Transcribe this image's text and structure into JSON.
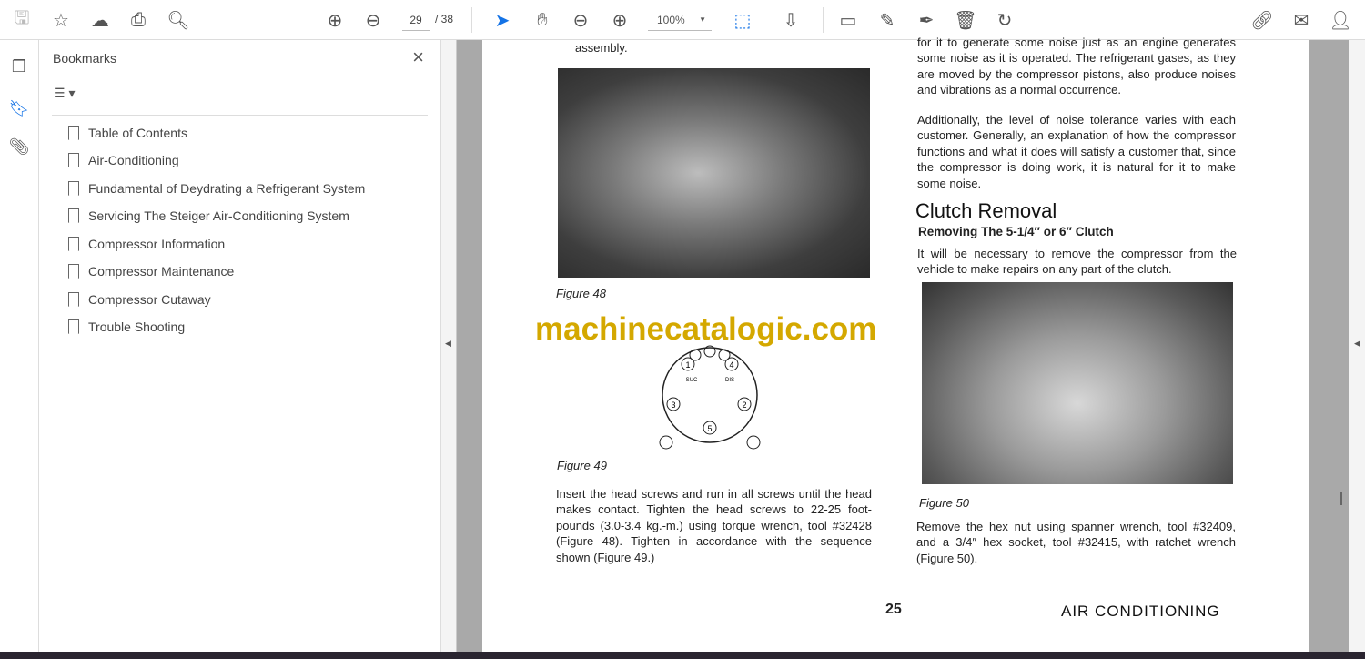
{
  "toolbar": {
    "page_current": "29",
    "page_total": "/ 38",
    "zoom": "100%",
    "icons": [
      "save-icon",
      "bookmark-star-icon",
      "upload-cloud-icon",
      "print-icon",
      "search-zoom-icon",
      "prev-page-icon",
      "next-page-icon",
      "select-cursor-icon",
      "hand-icon",
      "zoom-out-icon",
      "zoom-in-icon",
      "page-fit-icon",
      "scroll-mode-icon",
      "comment-icon",
      "highlight-icon",
      "sign-icon",
      "delete-icon",
      "rotate-icon",
      "link-icon",
      "email-icon",
      "account-icon"
    ]
  },
  "bookmarks": {
    "title": "Bookmarks",
    "items": [
      "Table of Contents",
      "Air-Conditioning",
      "Fundamental of Deydrating a Refrigerant System",
      "Servicing The Steiger Air-Conditioning System",
      "Compressor Information",
      "Compressor Maintenance",
      "Compressor Cutaway",
      "Trouble Shooting"
    ]
  },
  "page": {
    "left_top": "assembly.",
    "fig48": "Figure 48",
    "watermark": "machinecatalogic.com",
    "fig49_labels": {
      "n1": "1",
      "n2": "2",
      "n3": "3",
      "n4": "4",
      "n5": "5",
      "suc": "SUC",
      "dis": "DIS"
    },
    "fig49": "Figure 49",
    "left_para": "Insert the head screws and run in all screws until the head makes contact. Tighten the head screws to 22-25 foot-pounds (3.0-3.4 kg.-m.) using torque wrench, tool #32428 (Figure 48). Tighten in accordance with the sequence shown (Figure 49.)",
    "right_para1": "for it to generate some noise just as an engine generates some noise as it is operated. The refrigerant gases, as they are moved by the compressor pistons, also produce noises and vibrations as a normal occurrence.",
    "right_para2": "Additionally, the level of noise tolerance varies with each customer. Generally, an explanation of how the compressor functions and what it does will satisfy a customer that, since the compressor is doing work, it is natural for it to make some noise.",
    "heading": "Clutch Removal",
    "subheading": "Removing The 5-1/4″ or 6″ Clutch",
    "right_para3": "It will be necessary to remove the compressor from the vehicle to make repairs on any part of the clutch.",
    "fig50": "Figure 50",
    "right_para4": "Remove the hex nut using spanner wrench, tool #32409, and a 3/4″ hex socket, tool #32415, with ratchet wrench (Figure 50).",
    "page_number": "25",
    "footer": "AIR CONDITIONING"
  },
  "colors": {
    "accent": "#1473e6",
    "watermark": "#d4a800"
  }
}
